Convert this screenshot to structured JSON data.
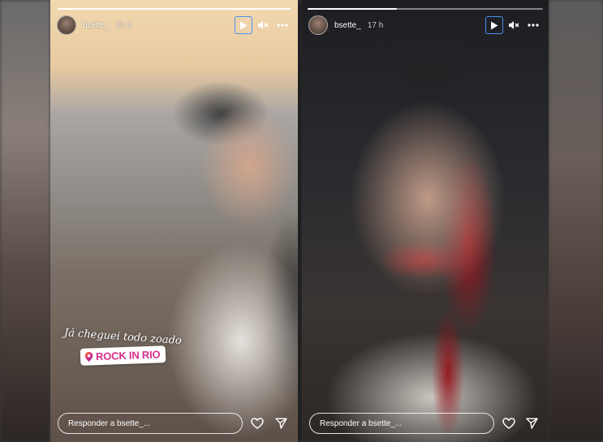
{
  "stories": [
    {
      "progress_fraction": 1.0,
      "username": "bsette_",
      "time_ago": "21 h",
      "caption": "Já cheguei todo zoado",
      "location_sticker": "ROCK IN RIO",
      "reply_placeholder": "Responder a bsette_..."
    },
    {
      "progress_fraction": 0.38,
      "username": "bsette_",
      "time_ago": "17 h",
      "reply_placeholder": "Responder a bsette_..."
    }
  ],
  "icons": {
    "play": "play-icon",
    "mute": "muted-speaker-icon",
    "more": "more-horizontal-icon",
    "like": "heart-icon",
    "share": "send-icon",
    "location": "location-pin-icon"
  },
  "colors": {
    "play_focus_ring": "#4a8ff0",
    "sticker_text": "#d92f8b"
  }
}
